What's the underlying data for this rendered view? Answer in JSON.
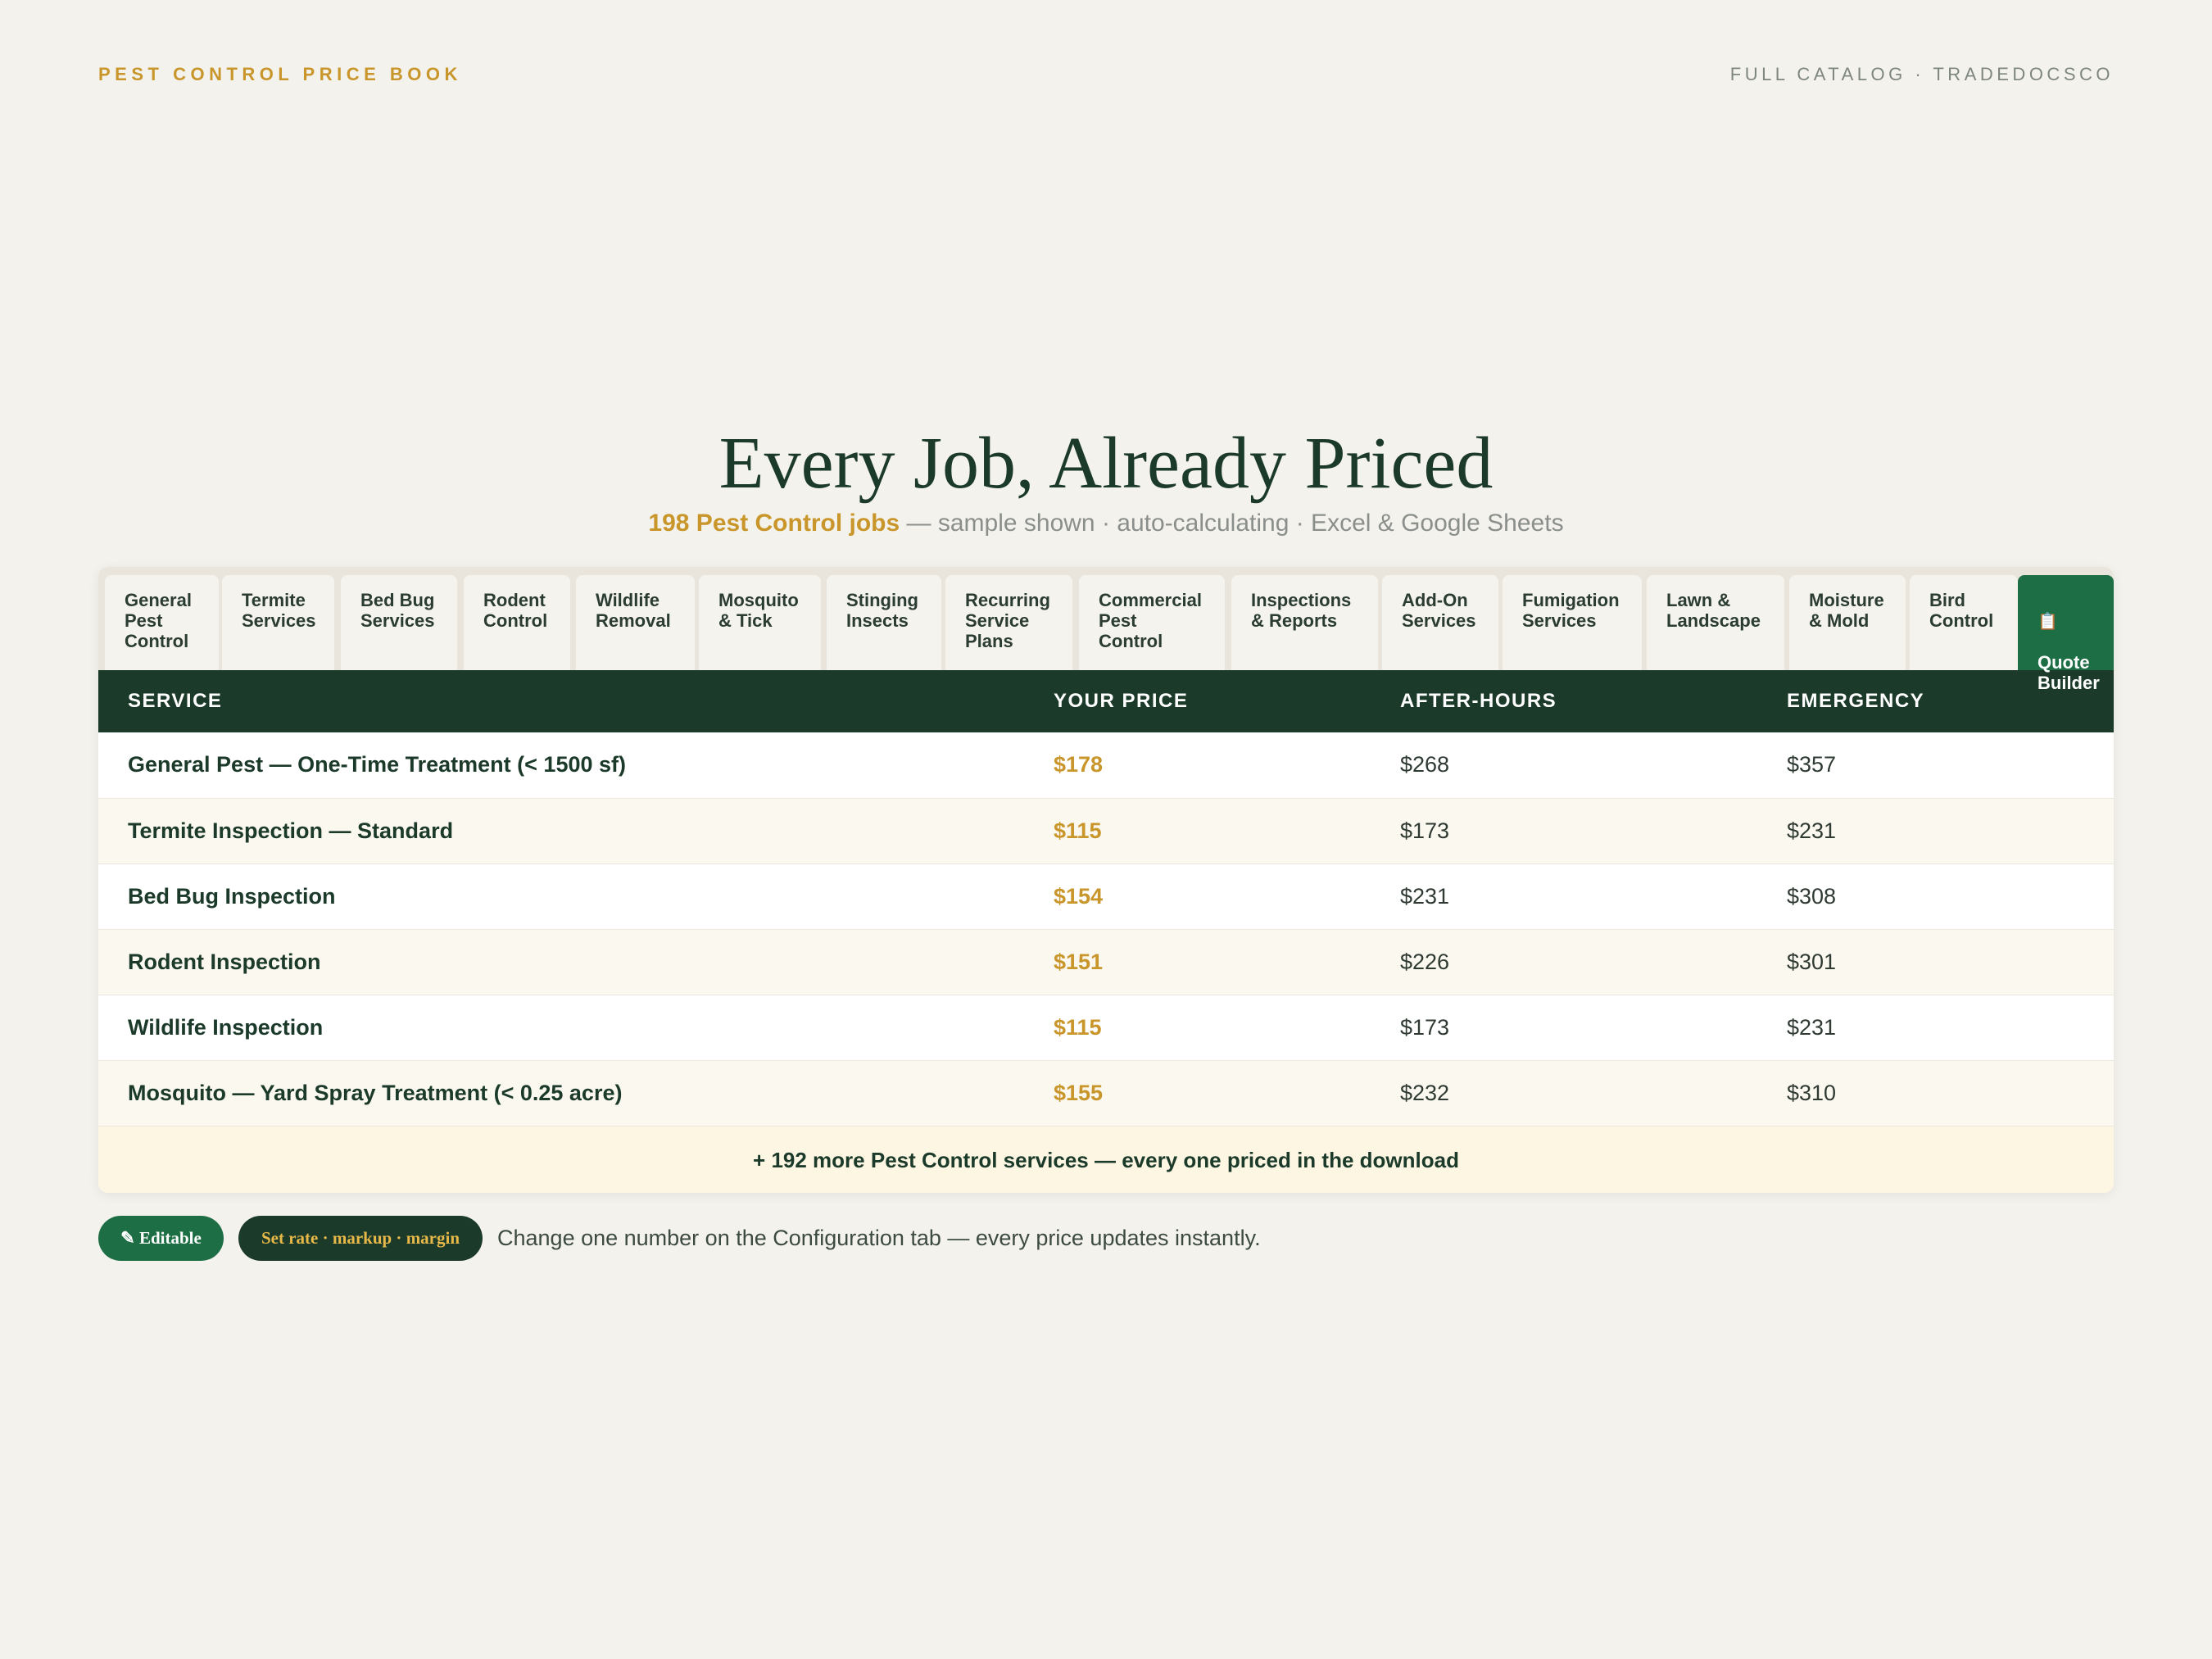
{
  "header": {
    "brand": "PEST CONTROL PRICE BOOK",
    "catalog": "FULL CATALOG · TRADEDOCSCO"
  },
  "hero": {
    "title": "Every Job, Already Priced",
    "highlight": "198 Pest Control jobs",
    "subtitle_rest": " — sample shown · auto-calculating · Excel & Google Sheets"
  },
  "tabs": [
    {
      "label": "General\nPest\nControl"
    },
    {
      "label": "Termite\nServices"
    },
    {
      "label": "Bed Bug\nServices"
    },
    {
      "label": "Rodent\nControl"
    },
    {
      "label": "Wildlife\nRemoval"
    },
    {
      "label": "Mosquito\n& Tick"
    },
    {
      "label": "Stinging\nInsects"
    },
    {
      "label": "Recurring\nService\nPlans"
    },
    {
      "label": "Commercial\nPest\nControl"
    },
    {
      "label": "Inspections\n& Reports"
    },
    {
      "label": "Add-On\nServices"
    },
    {
      "label": "Fumigation\nServices"
    },
    {
      "label": "Lawn &\nLandscape"
    },
    {
      "label": "Moisture\n& Mold"
    },
    {
      "label": "Bird\nControl"
    },
    {
      "label": "Quote\nBuilder",
      "icon": "📋",
      "icon_name": "clipboard-icon",
      "active": true
    }
  ],
  "table": {
    "columns": [
      "SERVICE",
      "YOUR PRICE",
      "AFTER-HOURS",
      "EMERGENCY"
    ],
    "rows": [
      {
        "service": "General Pest — One-Time Treatment (< 1500 sf)",
        "price": "$178",
        "after_hours": "$268",
        "emergency": "$357"
      },
      {
        "service": "Termite Inspection — Standard",
        "price": "$115",
        "after_hours": "$173",
        "emergency": "$231"
      },
      {
        "service": "Bed Bug Inspection",
        "price": "$154",
        "after_hours": "$231",
        "emergency": "$308"
      },
      {
        "service": "Rodent Inspection",
        "price": "$151",
        "after_hours": "$226",
        "emergency": "$301"
      },
      {
        "service": "Wildlife Inspection",
        "price": "$115",
        "after_hours": "$173",
        "emergency": "$231"
      },
      {
        "service": "Mosquito — Yard Spray Treatment (< 0.25 acre)",
        "price": "$155",
        "after_hours": "$232",
        "emergency": "$310"
      }
    ],
    "more": "+ 192 more Pest Control services — every one priced in the download"
  },
  "footer": {
    "edit_badge": "✎ Editable",
    "edit_icon_name": "pencil-icon",
    "rate_badge": "Set rate · markup · margin",
    "note": "Change one number on the Configuration tab — every price updates instantly."
  },
  "colors": {
    "background": "#f4f2ed",
    "dark_green": "#1b3a2a",
    "accent_green": "#1e6e45",
    "gold": "#c9962b",
    "row_alt": "#fbf8f0",
    "more_bg": "#fdf6e3"
  }
}
